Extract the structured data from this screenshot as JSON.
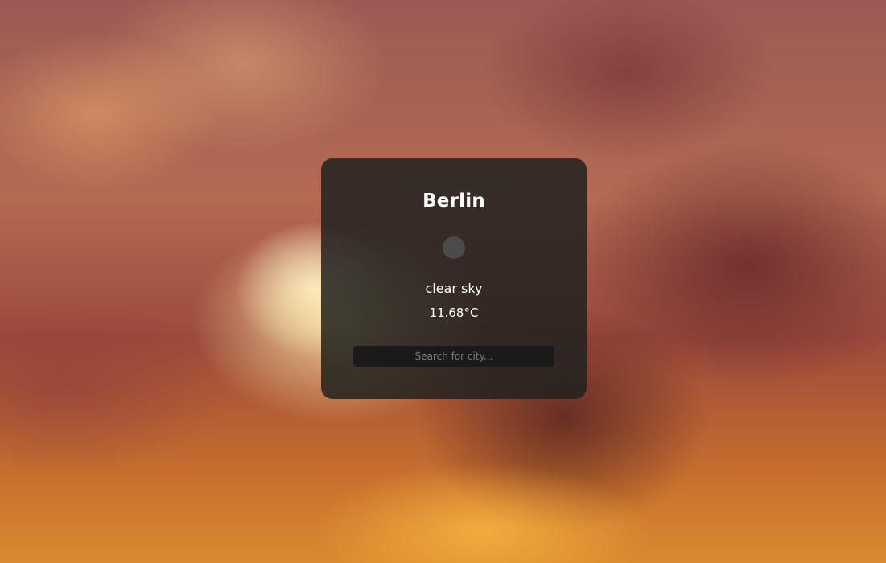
{
  "weather": {
    "city": "Berlin",
    "icon": "weather-icon",
    "description": "clear sky",
    "temperature": "11.68°C"
  },
  "search": {
    "placeholder": "Search for city..."
  }
}
